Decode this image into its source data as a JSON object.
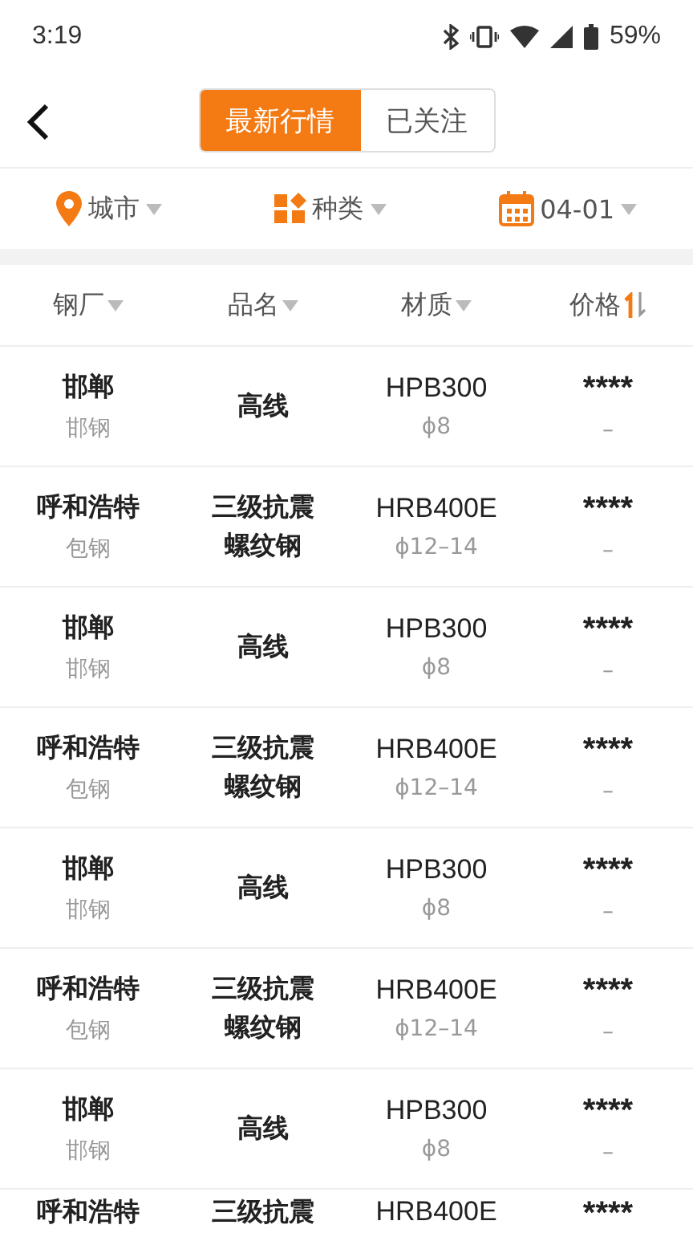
{
  "status_bar": {
    "time": "3:19",
    "battery": "59%"
  },
  "tabs": [
    {
      "label": "最新行情",
      "selected": true
    },
    {
      "label": "已关注",
      "selected": false
    }
  ],
  "filters": [
    {
      "kind": "location",
      "label": "城市"
    },
    {
      "kind": "category",
      "label": "种类"
    },
    {
      "kind": "date",
      "label": "04-01"
    }
  ],
  "columns": [
    {
      "label": "钢厂",
      "kind": "dropdown"
    },
    {
      "label": "品名",
      "kind": "dropdown"
    },
    {
      "label": "材质",
      "kind": "dropdown"
    },
    {
      "label": "价格",
      "kind": "sort"
    }
  ],
  "rows": [
    {
      "city": "邯郸",
      "mill": "邯钢",
      "product": "高线",
      "grade": "HPB300",
      "spec": "ϕ8",
      "price": "****",
      "change": "–"
    },
    {
      "city": "呼和浩特",
      "mill": "包钢",
      "product": "三级抗震螺纹钢",
      "grade": "HRB400E",
      "spec": "ϕ12–14",
      "price": "****",
      "change": "–"
    },
    {
      "city": "邯郸",
      "mill": "邯钢",
      "product": "高线",
      "grade": "HPB300",
      "spec": "ϕ8",
      "price": "****",
      "change": "–"
    },
    {
      "city": "呼和浩特",
      "mill": "包钢",
      "product": "三级抗震螺纹钢",
      "grade": "HRB400E",
      "spec": "ϕ12–14",
      "price": "****",
      "change": "–"
    },
    {
      "city": "邯郸",
      "mill": "邯钢",
      "product": "高线",
      "grade": "HPB300",
      "spec": "ϕ8",
      "price": "****",
      "change": "–"
    },
    {
      "city": "呼和浩特",
      "mill": "包钢",
      "product": "三级抗震螺纹钢",
      "grade": "HRB400E",
      "spec": "ϕ12–14",
      "price": "****",
      "change": "–"
    },
    {
      "city": "邯郸",
      "mill": "邯钢",
      "product": "高线",
      "grade": "HPB300",
      "spec": "ϕ8",
      "price": "****",
      "change": "–"
    },
    {
      "city": "呼和浩特",
      "product": "三级抗震",
      "grade": "HRB400E",
      "price": "****"
    }
  ]
}
